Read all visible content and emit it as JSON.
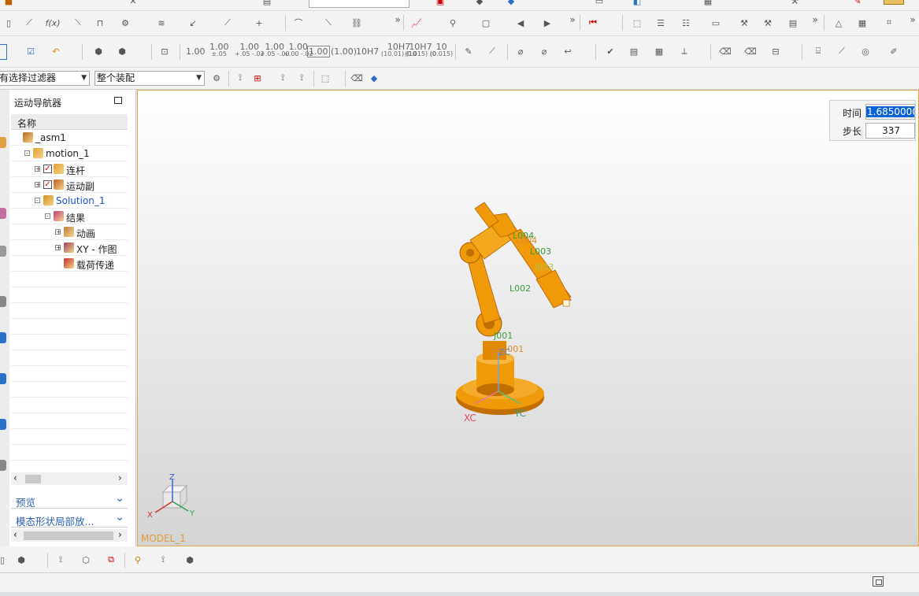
{
  "filter_row": {
    "selection_filter": "有选择过滤器",
    "scope": "整个装配"
  },
  "toolbar_numbers": [
    {
      "main": "1.00",
      "sub": ""
    },
    {
      "main": "1.00",
      "sub": "±.05"
    },
    {
      "main": "1.00",
      "sub": "+.05 -.02"
    },
    {
      "main": "1.00",
      "sub": "+.05 -.00"
    },
    {
      "main": "1.00",
      "sub": "+.00 -.02"
    },
    {
      "main": "1.00",
      "sub": ""
    },
    {
      "main": "(1.00)",
      "sub": ""
    },
    {
      "main": "10H7",
      "sub": ""
    },
    {
      "main": "10H7",
      "sub": "(10.01) (10"
    },
    {
      "main": "10H7",
      "sub": "(0.015) (0"
    },
    {
      "main": "10",
      "sub": "(0.015)"
    }
  ],
  "navigator": {
    "title": "运动导航器",
    "column_name": "名称",
    "tree": [
      {
        "label": "_asm1",
        "level": 0,
        "icon": "assembly-icon",
        "expander": "",
        "checkbox": false,
        "blue": false
      },
      {
        "label": "motion_1",
        "level": 1,
        "icon": "motion-icon",
        "expander": "-",
        "checkbox": false,
        "blue": false
      },
      {
        "label": "连杆",
        "level": 2,
        "icon": "link-icon",
        "expander": "+",
        "checkbox": true,
        "blue": false
      },
      {
        "label": "运动副",
        "level": 2,
        "icon": "joint-icon",
        "expander": "+",
        "checkbox": true,
        "blue": false
      },
      {
        "label": "Solution_1",
        "level": 2,
        "icon": "solution-icon",
        "expander": "-",
        "checkbox": false,
        "blue": true
      },
      {
        "label": "结果",
        "level": 3,
        "icon": "results-icon",
        "expander": "-",
        "checkbox": false,
        "blue": false
      },
      {
        "label": "动画",
        "level": 4,
        "icon": "animation-icon",
        "expander": "+",
        "checkbox": false,
        "blue": false
      },
      {
        "label": "XY - 作图",
        "level": 4,
        "icon": "xy-graph-icon",
        "expander": "+",
        "checkbox": false,
        "blue": false
      },
      {
        "label": "载荷传递",
        "level": 4,
        "icon": "load-transfer-icon",
        "expander": "",
        "checkbox": false,
        "blue": false
      }
    ],
    "preview_label": "预览",
    "modal_label": "模态形状局部放..."
  },
  "viewport": {
    "model_name": "MODEL_1",
    "time_label": "时间",
    "time_value": "1.6850000",
    "step_label": "步长",
    "step_value": "337",
    "link_labels": [
      "L004",
      "L004",
      "L003",
      "J003",
      "L002",
      "J001",
      "J001"
    ],
    "wcs_labels": {
      "xc": "XC",
      "yc": "YC",
      "zc": "ZC"
    },
    "triad_labels": {
      "x": "X",
      "y": "Y",
      "z": "Z"
    },
    "colors": {
      "robot": "#f09a0a",
      "robot_dark": "#c06f00",
      "label_green": "#3a9b3a",
      "label_orange": "#e08a2a"
    }
  }
}
